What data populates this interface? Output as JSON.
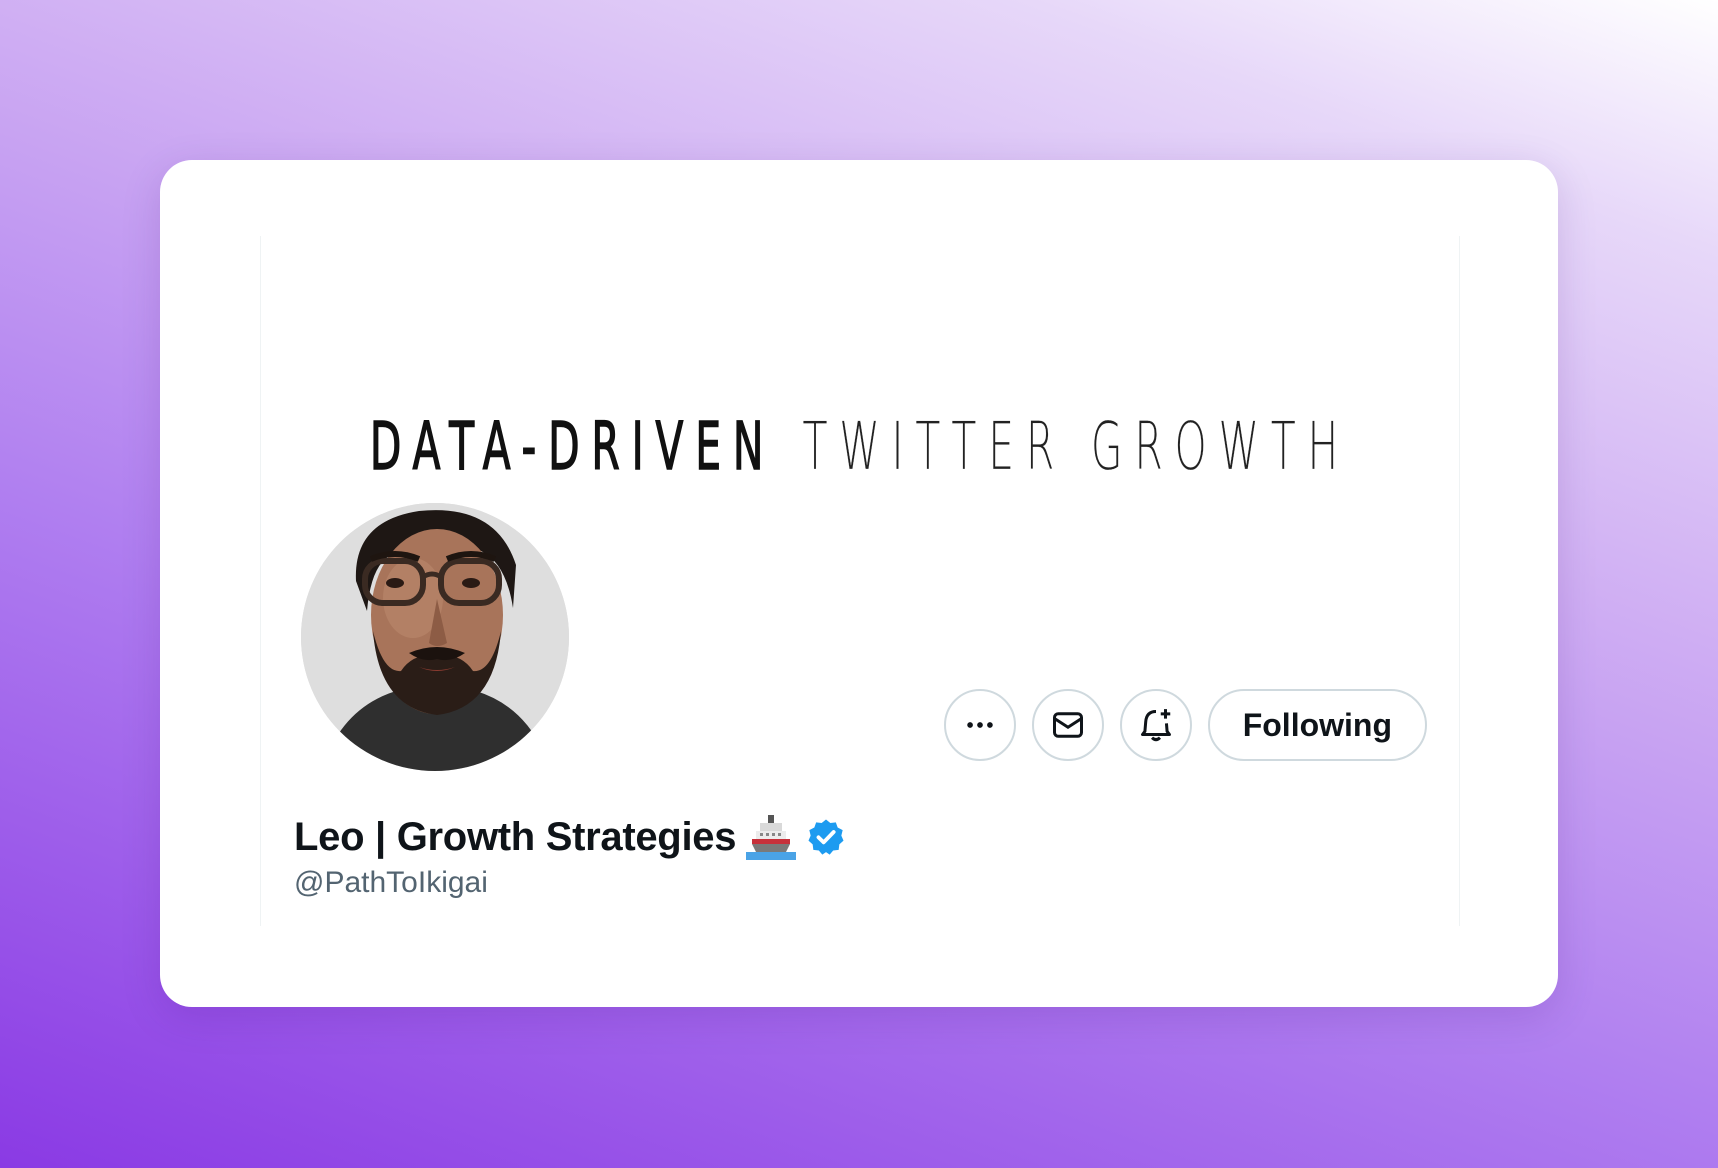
{
  "banner": {
    "text_bold": "DATA-DRIVEN",
    "text_thin": "TWITTER GROWTH"
  },
  "profile": {
    "display_name": "Leo | Growth Strategies",
    "handle": "@PathToIkigai",
    "name_emoji": "ship-icon",
    "verified_badge": "verified-badge-icon",
    "avatar": "profile-photo-bearded-man-glasses"
  },
  "actions": {
    "more_icon": "more-dots-icon",
    "message_icon": "envelope-icon",
    "notify_icon": "bell-plus-icon",
    "follow_label": "Following"
  },
  "colors": {
    "verified_blue": "#1d9bf0",
    "text_primary": "#0f1419",
    "text_secondary": "#536471",
    "button_border": "#cfd9de"
  }
}
